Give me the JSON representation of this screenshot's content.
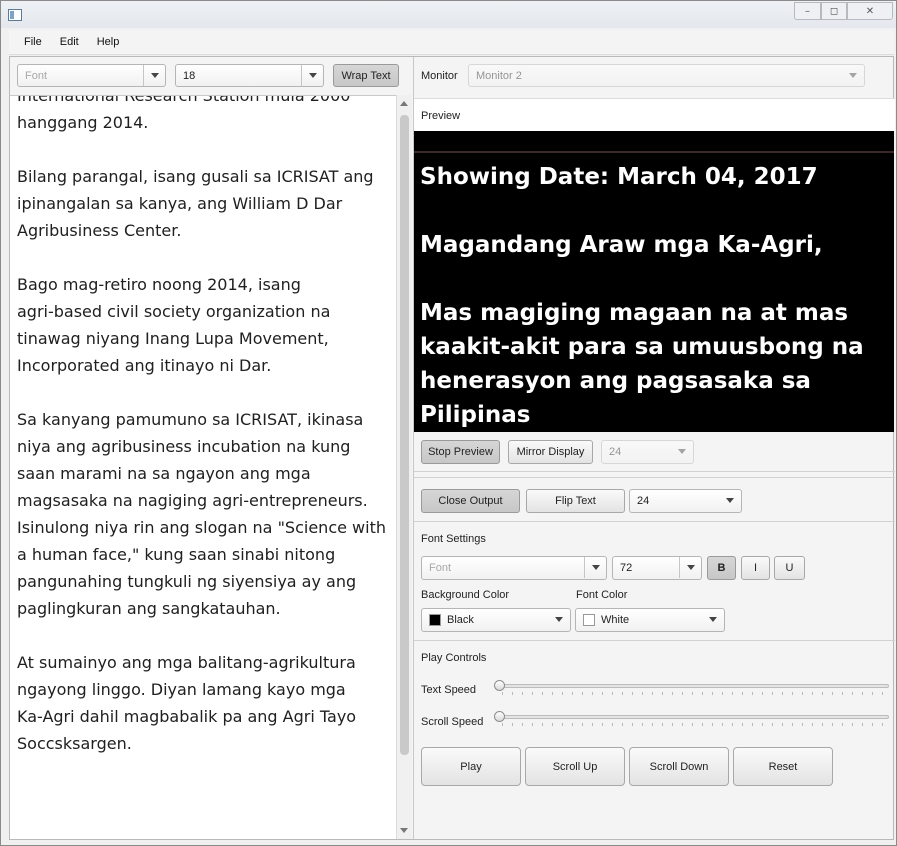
{
  "window": {
    "controls": {
      "minimize": "–",
      "maximize": "◻",
      "close": "✕"
    }
  },
  "menu": {
    "items": [
      "File",
      "Edit",
      "Help"
    ]
  },
  "editor_toolbar": {
    "font_placeholder": "Font",
    "font_size": "18",
    "wrap_text_label": "Wrap Text"
  },
  "editor": {
    "text": "International Research Station mula 2000\nhanggang 2014.\n\nBilang parangal, isang gusali sa ICRISAT ang\nipinangalan sa kanya, ang William D Dar\nAgribusiness Center.\n\nBago mag-retiro noong 2014, isang\nagri-based civil society organization na\ntinawag niyang Inang Lupa Movement,\nIncorporated ang itinayo ni Dar.\n\nSa kanyang pamumuno sa ICRISAT, ikinasa\nniya ang agribusiness incubation na kung\nsaan marami na sa ngayon ang mga\nmagsasaka na nagiging agri-entrepreneurs.\nIsinulong niya rin ang slogan na \"Science with\na human face,\" kung saan sinabi nitong\npangunahing tungkuli ng siyensiya ay ang\npaglingkuran ang sangkatauhan.\n\nAt sumainyo ang mga balitang-agrikultura\nngayong linggo. Diyan lamang kayo mga\nKa-Agri dahil magbabalik pa ang Agri Tayo\nSoccsksargen."
  },
  "monitor": {
    "label": "Monitor",
    "value": "Monitor 2"
  },
  "preview": {
    "label": "Preview",
    "text": "Showing Date: March 04, 2017\n\nMagandang Araw mga Ka-Agri,\n\nMas magiging magaan na at mas\nkaakit-akit para sa umuusbong na\nhenerasyon ang pagsasaka sa Pilipinas\nkapag maabot ng bansa ang sukdulan",
    "stop_preview_label": "Stop Preview",
    "mirror_display_label": "Mirror Display",
    "size_value": "24"
  },
  "output": {
    "close_output_label": "Close Output",
    "flip_text_label": "Flip Text",
    "size_value": "24"
  },
  "font_settings": {
    "label": "Font Settings",
    "font_placeholder": "Font",
    "size_value": "72",
    "bold_label": "B",
    "italic_label": "I",
    "underline_label": "U",
    "background_color_label": "Background Color",
    "background_color_value": "Black",
    "background_color_hex": "#000000",
    "font_color_label": "Font Color",
    "font_color_value": "White",
    "font_color_hex": "#ffffff"
  },
  "play_controls": {
    "label": "Play Controls",
    "text_speed_label": "Text Speed",
    "text_speed_value": 0,
    "scroll_speed_label": "Scroll Speed",
    "scroll_speed_value": 0,
    "play_label": "Play",
    "scroll_up_label": "Scroll Up",
    "scroll_down_label": "Scroll Down",
    "reset_label": "Reset"
  }
}
